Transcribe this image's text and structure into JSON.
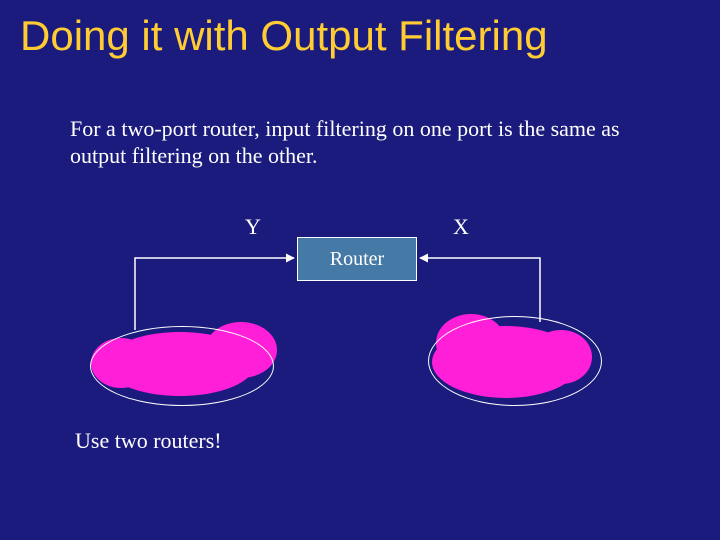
{
  "title": "Doing it with Output Filtering",
  "body": "For a two-port router, input filtering on one port is the same as output filtering on the other.",
  "labels": {
    "y": "Y",
    "x": "X"
  },
  "router": {
    "label": "Router"
  },
  "footnote": "Use two routers!",
  "colors": {
    "background": "#1b1b7d",
    "accent_title": "#ffcc33",
    "router_fill": "#467aa6",
    "cloud": "#ff1fd9",
    "text": "#ffffff"
  }
}
